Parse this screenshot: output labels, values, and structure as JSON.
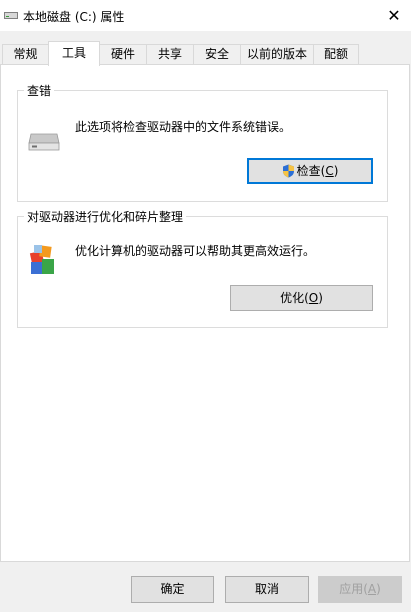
{
  "window": {
    "title": "本地磁盘 (C:) 属性",
    "close_glyph": "✕"
  },
  "tabs": [
    {
      "label": "常规"
    },
    {
      "label": "工具"
    },
    {
      "label": "硬件"
    },
    {
      "label": "共享"
    },
    {
      "label": "安全"
    },
    {
      "label": "以前的版本"
    },
    {
      "label": "配额"
    }
  ],
  "active_tab": "工具",
  "error_checking": {
    "group_title": "查错",
    "description": "此选项将检查驱动器中的文件系统错误。",
    "button_label": "检查",
    "button_mnemonic": "C"
  },
  "optimize": {
    "group_title": "对驱动器进行优化和碎片整理",
    "description": "优化计算机的驱动器可以帮助其更高效运行。",
    "button_label": "优化",
    "button_mnemonic": "O"
  },
  "footer": {
    "ok_label": "确定",
    "cancel_label": "取消",
    "apply_label": "应用",
    "apply_mnemonic": "A"
  }
}
